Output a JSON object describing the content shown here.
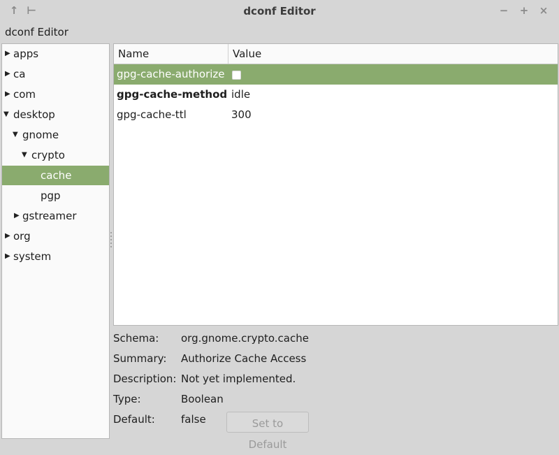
{
  "window": {
    "title": "dconf Editor",
    "menu_label": "dconf Editor"
  },
  "sidebar": {
    "items": [
      {
        "label": "apps",
        "expander": "collapsed"
      },
      {
        "label": "ca",
        "expander": "collapsed"
      },
      {
        "label": "com",
        "expander": "collapsed"
      },
      {
        "label": "desktop",
        "expander": "expanded"
      },
      {
        "label": "gnome",
        "expander": "expanded"
      },
      {
        "label": "crypto",
        "expander": "expanded"
      },
      {
        "label": "cache",
        "expander": "none",
        "selected": true
      },
      {
        "label": "pgp",
        "expander": "none"
      },
      {
        "label": "gstreamer",
        "expander": "collapsed"
      },
      {
        "label": "org",
        "expander": "collapsed"
      },
      {
        "label": "system",
        "expander": "collapsed"
      }
    ]
  },
  "table": {
    "headers": {
      "name": "Name",
      "value": "Value"
    },
    "rows": [
      {
        "name": "gpg-cache-authorize",
        "value_type": "checkbox",
        "checked": false,
        "selected": true
      },
      {
        "name": "gpg-cache-method",
        "value": "idle",
        "bold": true
      },
      {
        "name": "gpg-cache-ttl",
        "value": "300"
      }
    ]
  },
  "details": {
    "schema_label": "Schema:",
    "schema": "org.gnome.crypto.cache",
    "summary_label": "Summary:",
    "summary": "Authorize Cache Access",
    "description_label": "Description:",
    "description": "Not yet implemented.",
    "type_label": "Type:",
    "type": "Boolean",
    "default_label": "Default:",
    "default": "false",
    "set_default_label": "Set to Default"
  },
  "colors": {
    "selection": "#8aab6e",
    "window_bg": "#d6d6d6"
  }
}
